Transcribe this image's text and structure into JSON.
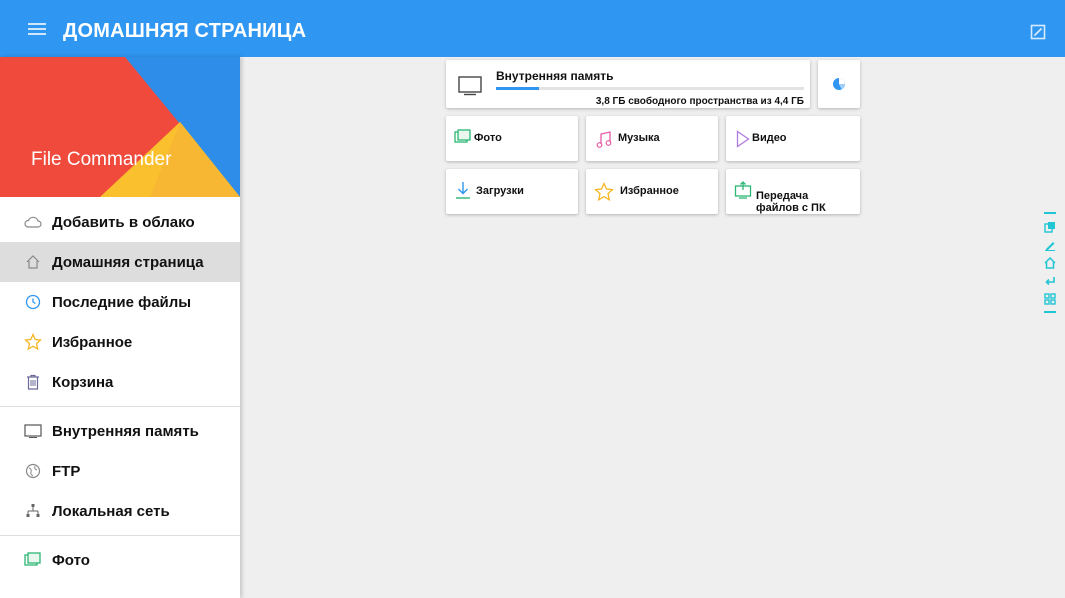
{
  "header": {
    "title": "ДОМАШНЯЯ СТРАНИЦА",
    "menu_icon": "hamburger-icon",
    "action_icon": "edit-icon"
  },
  "sidebar": {
    "brand": "File Commander",
    "items": [
      {
        "label": "Добавить в облако",
        "icon": "cloud-icon"
      },
      {
        "label": "Домашняя страница",
        "icon": "home-icon",
        "active": true
      },
      {
        "label": "Последние файлы",
        "icon": "clock-icon"
      },
      {
        "label": "Избранное",
        "icon": "star-icon"
      },
      {
        "label": "Корзина",
        "icon": "trash-icon"
      },
      {
        "label": "Внутренняя память",
        "icon": "monitor-icon"
      },
      {
        "label": "FTP",
        "icon": "globe-icon"
      },
      {
        "label": "Локальная сеть",
        "icon": "network-icon"
      },
      {
        "label": "Фото",
        "icon": "photo-icon"
      }
    ]
  },
  "storage": {
    "label": "Внутренняя память",
    "free_text": "3,8 ГБ свободного пространства из 4,4 ГБ",
    "used_fraction": 0.14
  },
  "tiles": [
    {
      "label": "Фото",
      "icon": "photo-icon"
    },
    {
      "label": "Музыка",
      "icon": "music-icon"
    },
    {
      "label": "Видео",
      "icon": "video-icon"
    },
    {
      "label": "Загрузки",
      "icon": "download-icon"
    },
    {
      "label": "Избранное",
      "icon": "star-icon"
    },
    {
      "label_line1": "Передача",
      "label_line2": "файлов с ПК",
      "icon": "pc-transfer-icon"
    }
  ],
  "colors": {
    "accent": "#2f96f1",
    "rail": "#21c6d4"
  }
}
